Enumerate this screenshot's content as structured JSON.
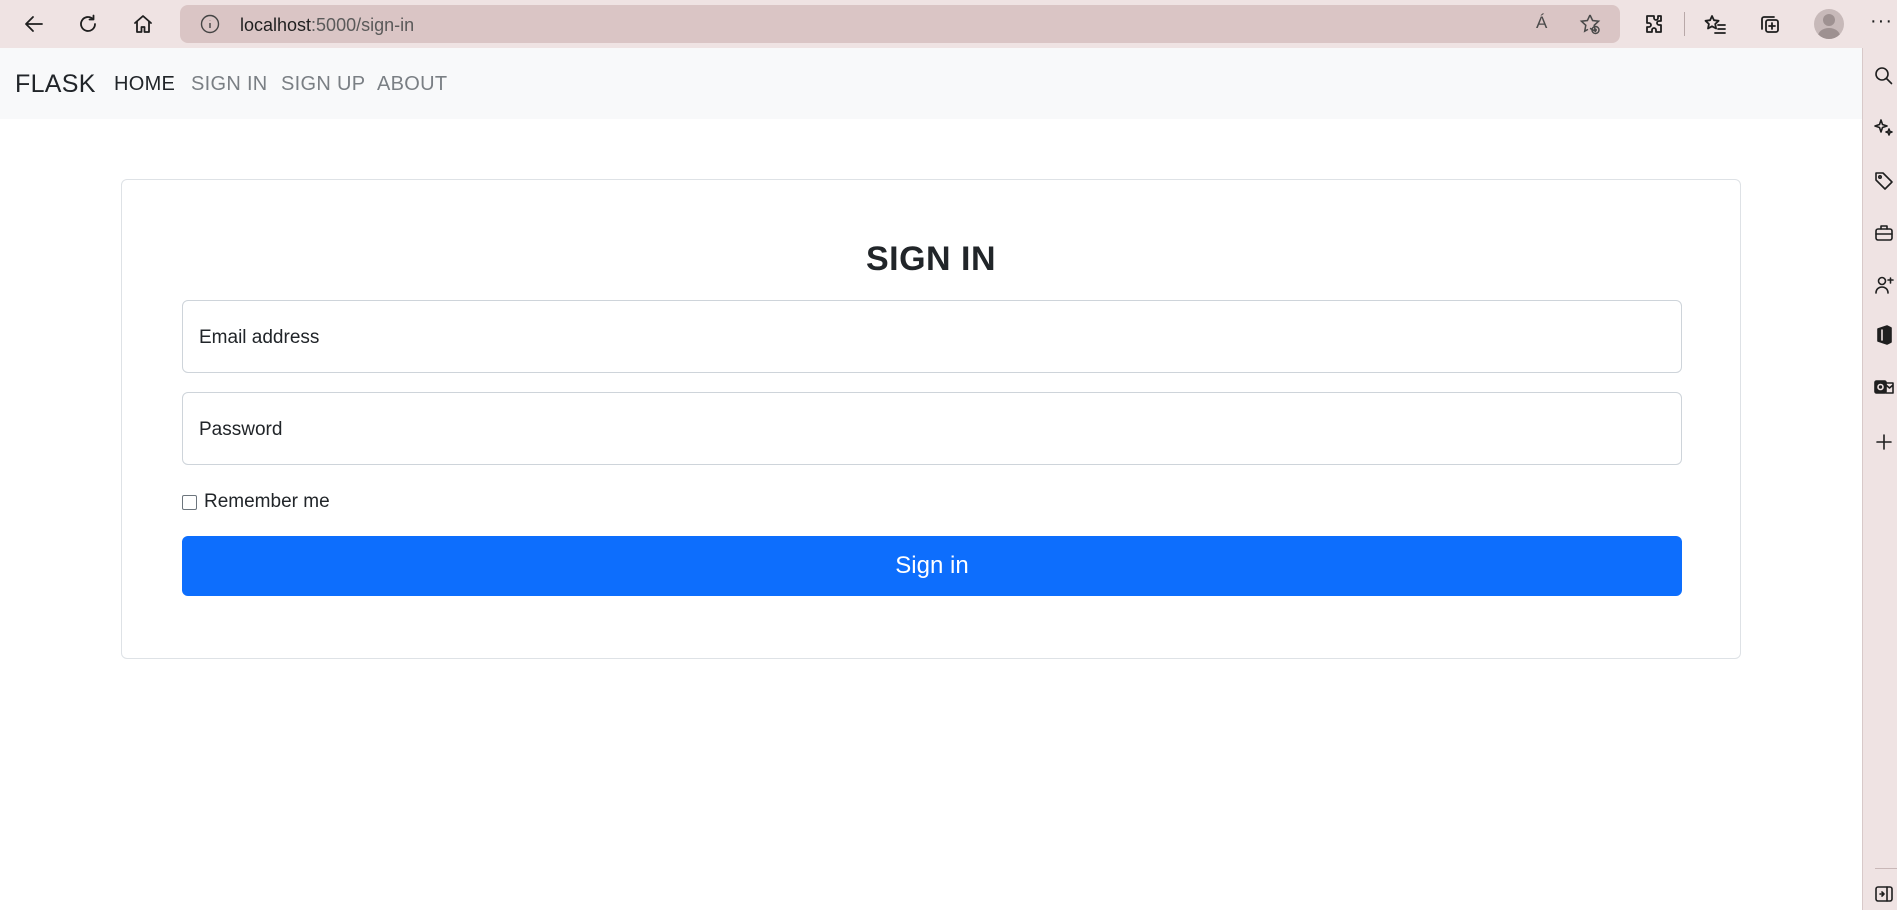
{
  "browser": {
    "url_host": "localhost",
    "url_rest": ":5000/sign-in",
    "read_aloud_label": "Á"
  },
  "navbar": {
    "brand": "FLASK",
    "links": [
      {
        "label": "HOME",
        "active": true
      },
      {
        "label": "SIGN IN",
        "active": false
      },
      {
        "label": "SIGN UP",
        "active": false
      },
      {
        "label": "ABOUT",
        "active": false
      }
    ]
  },
  "form": {
    "title": "SIGN IN",
    "email_label": "Email address",
    "password_label": "Password",
    "remember_label": "Remember me",
    "remember_checked": false,
    "submit_label": "Sign in"
  },
  "colors": {
    "primary": "#0d6efd",
    "navbar_bg": "#f8f9fa",
    "browser_chrome": "#efe3e3"
  },
  "icons": {
    "toolbar": [
      "back-arrow-icon",
      "refresh-icon",
      "home-icon",
      "info-icon",
      "read-aloud-icon",
      "add-favorite-icon",
      "extensions-icon",
      "favorites-icon",
      "collections-icon",
      "profile-avatar",
      "more-icon"
    ],
    "sidebar": [
      "search-icon",
      "sparkle-icon",
      "tag-icon",
      "briefcase-icon",
      "user-tools-icon",
      "office-icon",
      "outlook-icon",
      "add-icon",
      "sidebar-toggle-icon"
    ]
  }
}
